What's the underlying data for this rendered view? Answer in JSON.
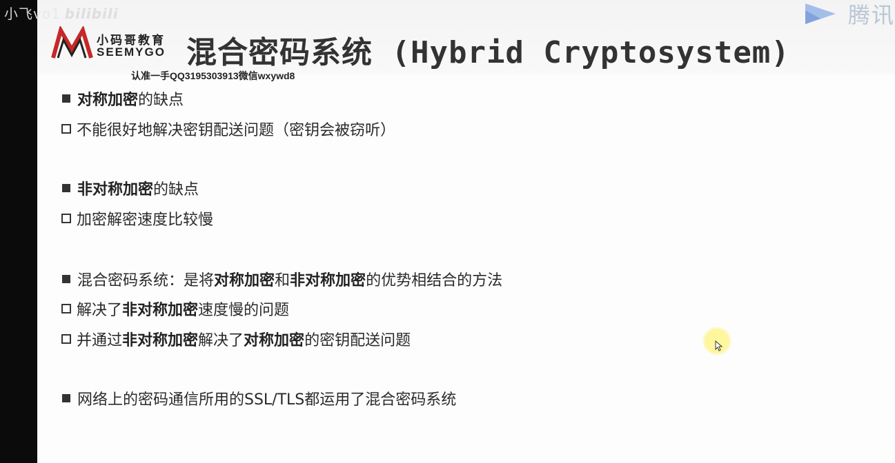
{
  "overlay": {
    "uploader": "小飞vo1",
    "site_logo_text": "bilibili",
    "brand_right": "腾讯"
  },
  "logo": {
    "cn": "小码哥教育",
    "en": "SEEMYGO"
  },
  "contact": "认准一手QQ3195303913微信wxywd8",
  "title": "混合密码系统 (Hybrid Cryptosystem)",
  "lines": {
    "l1": {
      "a": "对称加密",
      "b": "的缺点"
    },
    "l2": {
      "a": "不能很好地解决密钥配送问题（密钥会被窃听）"
    },
    "l3": {
      "a": "非对称加密",
      "b": "的缺点"
    },
    "l4": {
      "a": "加密解密速度比较慢"
    },
    "l5": {
      "a": "混合密码系统：是将",
      "b": "对称加密",
      "c": "和",
      "d": "非对称加密",
      "e": "的优势相结合的方法"
    },
    "l6": {
      "a": "解决了",
      "b": "非对称加密",
      "c": "速度慢的问题"
    },
    "l7": {
      "a": "并通过",
      "b": "非对称加密",
      "c": "解决了",
      "d": "对称加密",
      "e": "的密钥配送问题"
    },
    "l8": {
      "a": "网络上的密码通信所用的SSL/TLS都运用了混合密码系统"
    }
  },
  "icons": {
    "play": "play-icon",
    "logo": "logo-mark-icon",
    "cursor": "mouse-pointer-icon"
  },
  "colors": {
    "background": "#fdfdfd",
    "text": "#2a2a2a",
    "logo_red": "#c62828",
    "highlight": "#fff89a"
  }
}
